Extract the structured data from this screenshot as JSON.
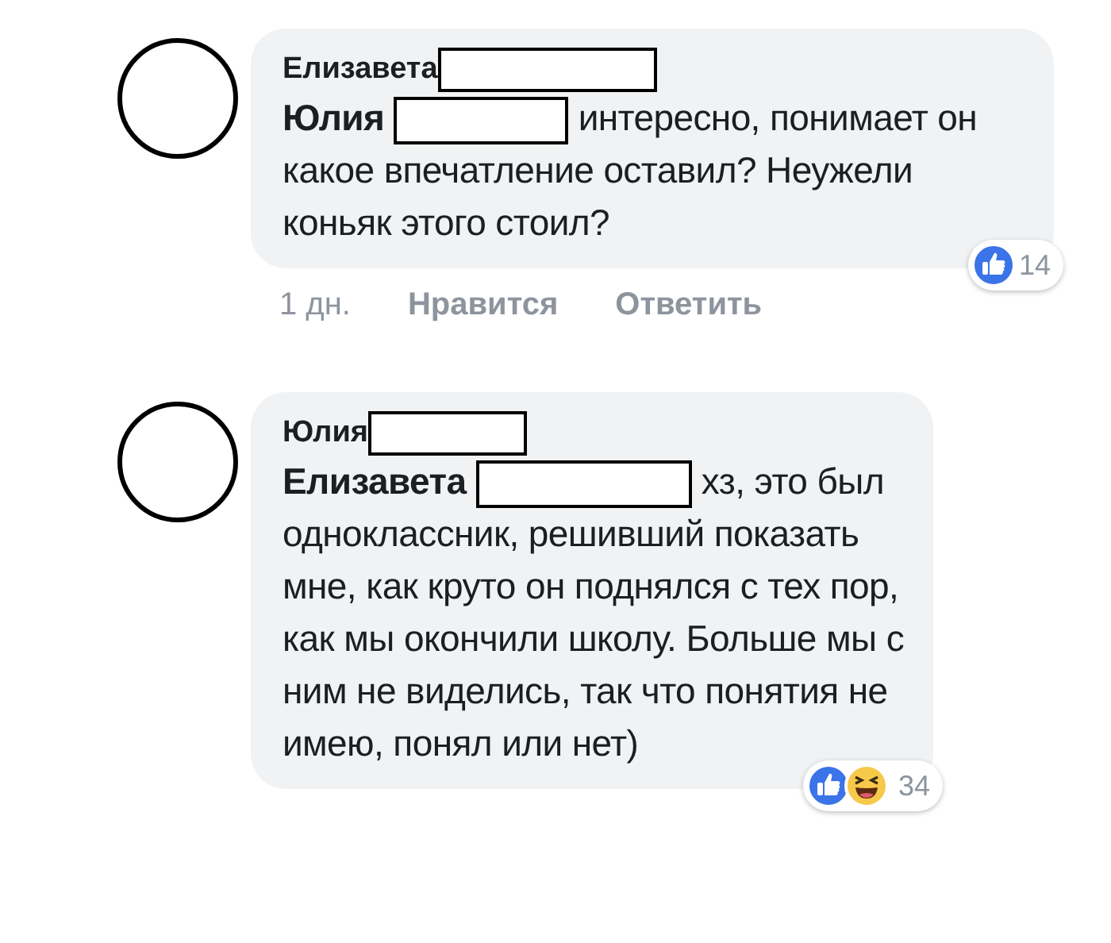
{
  "comments": [
    {
      "author": "Елизавета",
      "mention": "Юлия",
      "text": "интересно, понимает он какое впечатление оставил? Неужели  коньяк этого стоил?",
      "actions": {
        "time": "1 дн.",
        "like": "Нравится",
        "reply": "Ответить"
      },
      "reactions": [
        {
          "kind": "like"
        }
      ],
      "reaction_count": "14"
    },
    {
      "author": "Юлия",
      "mention": "Елизавета",
      "text": "хз, это был одноклассник, решивший показать мне, как круто он поднялся с тех пор, как мы окончили школу. Больше мы с ним не виделись, так что понятия не имею, понял или нет)",
      "reactions": [
        {
          "kind": "like"
        },
        {
          "kind": "haha"
        }
      ],
      "reaction_count": "34"
    }
  ]
}
